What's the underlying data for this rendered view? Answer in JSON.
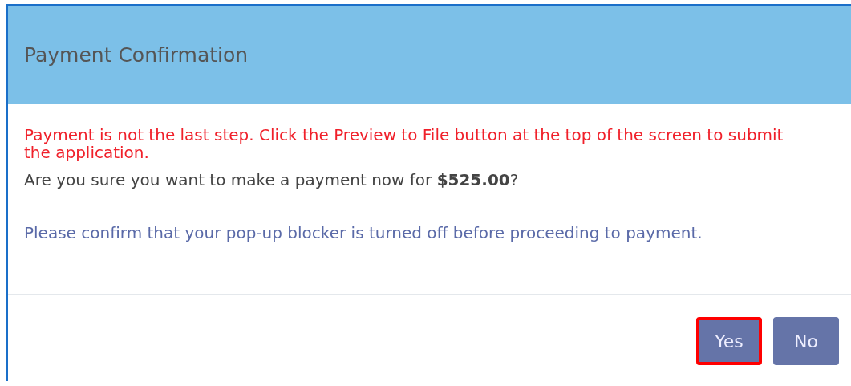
{
  "dialog": {
    "title": "Payment Confirmation",
    "warning": "Payment is not the last step. Click the Preview to File button at the top of the screen to submit the application.",
    "question": "Are you sure you want to make a payment now for **$525.00**?",
    "notice": "Please confirm that your pop-up blocker is turned off before proceeding to payment.",
    "buttons": [
      {
        "label": "Yes",
        "highlighted": true
      },
      {
        "label": "No",
        "highlighted": false
      }
    ]
  }
}
